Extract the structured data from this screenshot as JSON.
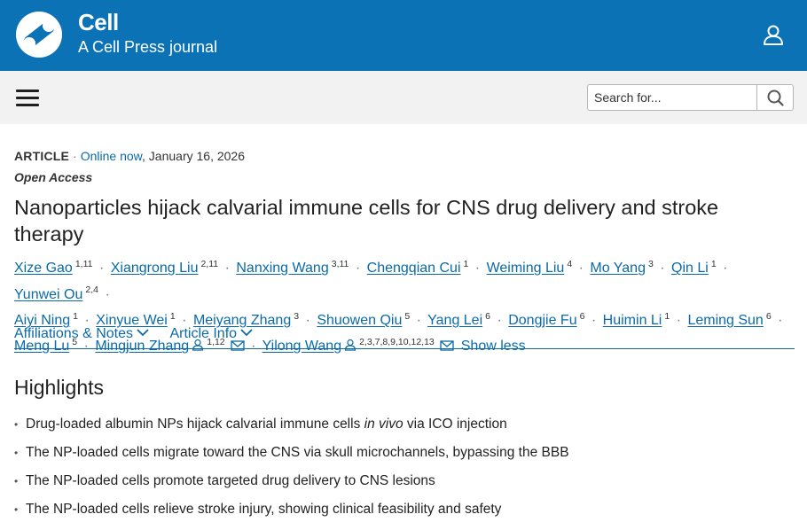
{
  "header": {
    "brand_title": "Cell",
    "brand_subtitle": "A Cell Press journal",
    "accent_color": "#0a72b5"
  },
  "nav": {
    "search_placeholder": "Search for..."
  },
  "article": {
    "type": "ARTICLE",
    "online_label": "Online now",
    "date": ", January 16, 2026",
    "access": "Open Access",
    "title": "Nanoparticles hijack calvarial immune cells for CNS drug delivery and stroke therapy",
    "authors": [
      {
        "name": "Xize Gao",
        "aff": "1,11"
      },
      {
        "name": "Xiangrong Liu",
        "aff": "2,11"
      },
      {
        "name": "Nanxing Wang",
        "aff": "3,11"
      },
      {
        "name": "Chengqian Cui",
        "aff": "1"
      },
      {
        "name": "Weiming Liu",
        "aff": "4"
      },
      {
        "name": "Mo Yang",
        "aff": "3"
      },
      {
        "name": "Qin Li",
        "aff": "1"
      },
      {
        "name": "Yunwei Ou",
        "aff": "2,4"
      },
      {
        "name": "Aiyi Ning",
        "aff": "1"
      },
      {
        "name": "Xinyue Wei",
        "aff": "1"
      },
      {
        "name": "Meiyang Zhang",
        "aff": "3"
      },
      {
        "name": "Shuowen Qiu",
        "aff": "5"
      },
      {
        "name": "Yang Lei",
        "aff": "6"
      },
      {
        "name": "Dongjie Fu",
        "aff": "6"
      },
      {
        "name": "Huimin Li",
        "aff": "1"
      },
      {
        "name": "Leming Sun",
        "aff": "6"
      },
      {
        "name": "Meng Lu",
        "aff": "5"
      },
      {
        "name": "Mingjun Zhang",
        "aff": "1,12"
      },
      {
        "name": "Yilong Wang",
        "aff": "2,3,7,8,9,10,12,13"
      }
    ],
    "show_less": "Show less",
    "tabs": [
      "Affiliations & Notes",
      "Article Info"
    ]
  },
  "highlights": {
    "title": "Highlights",
    "items": [
      {
        "before": "Drug-loaded albumin NPs hijack calvarial immune cells ",
        "italic": "in vivo",
        "after": " via ICO injection"
      },
      {
        "before": "The NP-loaded cells migrate toward the CNS via skull microchannels, bypassing the BBB",
        "italic": "",
        "after": ""
      },
      {
        "before": "The NP-loaded cells promote targeted drug delivery to CNS lesions",
        "italic": "",
        "after": ""
      },
      {
        "before": "The NP-loaded cells relieve stroke injury, showing clinical feasibility and safety",
        "italic": "",
        "after": ""
      }
    ]
  }
}
